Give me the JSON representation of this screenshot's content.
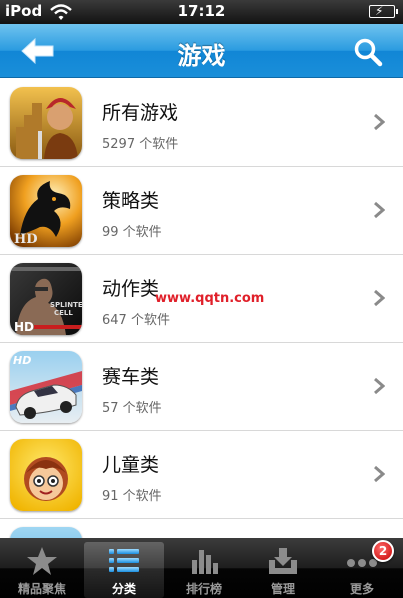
{
  "status_bar": {
    "carrier": "iPod",
    "time": "17:12"
  },
  "nav": {
    "title": "游戏"
  },
  "categories": [
    {
      "name": "所有游戏",
      "count": "5297 个软件",
      "icon": "temple-warrior-icon"
    },
    {
      "name": "策略类",
      "count": "99 个软件",
      "icon": "dragon-hd-icon"
    },
    {
      "name": "动作类",
      "count": "647 个软件",
      "icon": "splinter-cell-hd-icon"
    },
    {
      "name": "赛车类",
      "count": "57 个软件",
      "icon": "race-car-hd-icon"
    },
    {
      "name": "儿童类",
      "count": "91 个软件",
      "icon": "cartoon-kid-icon"
    }
  ],
  "watermark": "www.qqtn.com",
  "tabs": [
    {
      "label": "精品聚焦",
      "icon": "star-icon",
      "active": false
    },
    {
      "label": "分类",
      "icon": "list-icon",
      "active": true
    },
    {
      "label": "排行榜",
      "icon": "bar-chart-icon",
      "active": false
    },
    {
      "label": "管理",
      "icon": "download-tray-icon",
      "active": false
    },
    {
      "label": "更多",
      "icon": "more-dots-icon",
      "active": false,
      "badge": "2"
    }
  ],
  "colors": {
    "nav_blue": "#2a9be0",
    "tab_bar": "#1e1e1e",
    "badge_red": "#d40000"
  }
}
